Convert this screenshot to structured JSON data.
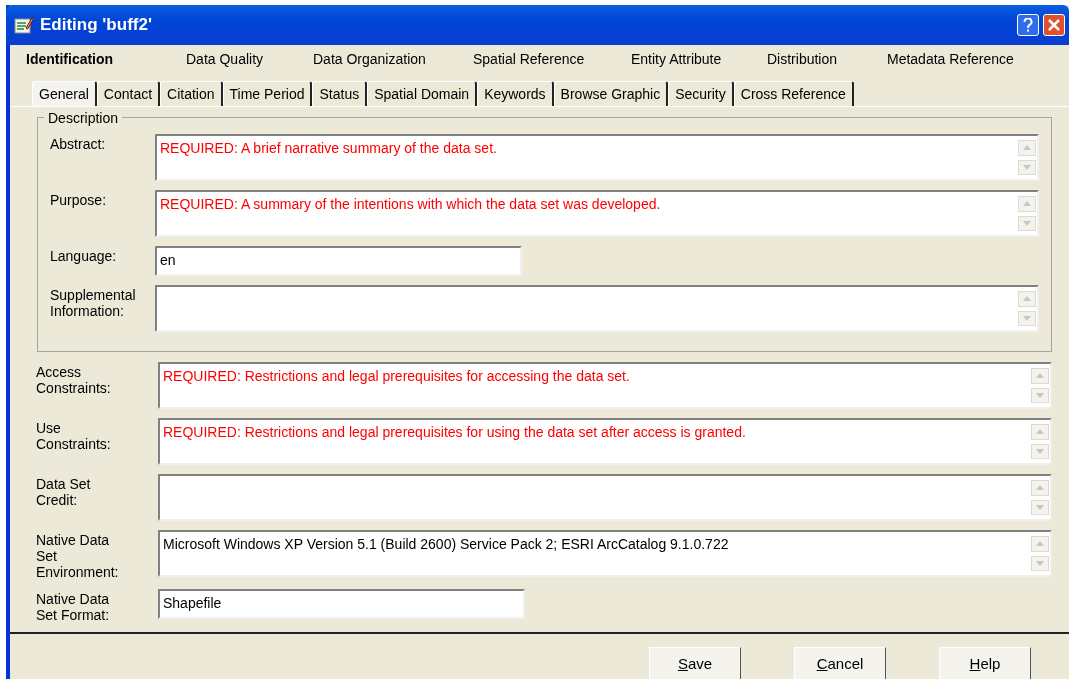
{
  "window": {
    "title": "Editing 'buff2'"
  },
  "main_tabs": [
    {
      "label": "Identification",
      "selected": true
    },
    {
      "label": "Data Quality",
      "selected": false
    },
    {
      "label": "Data Organization",
      "selected": false
    },
    {
      "label": "Spatial Reference",
      "selected": false
    },
    {
      "label": "Entity Attribute",
      "selected": false
    },
    {
      "label": "Distribution",
      "selected": false
    },
    {
      "label": "Metadata Reference",
      "selected": false
    }
  ],
  "sub_tabs": [
    {
      "label": "General",
      "selected": true
    },
    {
      "label": "Contact",
      "selected": false
    },
    {
      "label": "Citation",
      "selected": false
    },
    {
      "label": "Time Period",
      "selected": false
    },
    {
      "label": "Status",
      "selected": false
    },
    {
      "label": "Spatial Domain",
      "selected": false
    },
    {
      "label": "Keywords",
      "selected": false
    },
    {
      "label": "Browse Graphic",
      "selected": false
    },
    {
      "label": "Security",
      "selected": false
    },
    {
      "label": "Cross Reference",
      "selected": false
    }
  ],
  "description_group": {
    "title": "Description",
    "fields": [
      {
        "label": "Abstract:",
        "kind": "multiline",
        "value": "REQUIRED: A brief narrative summary of the data set.",
        "required": true
      },
      {
        "label": "Purpose:",
        "kind": "multiline",
        "value": "REQUIRED: A summary of the intentions with which the data set was developed.",
        "required": true
      },
      {
        "label": "Language:",
        "kind": "single",
        "value": "en",
        "required": false
      },
      {
        "label": "Supplemental Information:",
        "kind": "multiline"
      }
    ]
  },
  "fields": [
    {
      "label": "Access Constraints:",
      "kind": "multiline",
      "value": "REQUIRED: Restrictions and legal prerequisites for accessing the data set.",
      "required": true
    },
    {
      "label": "Use Constraints:",
      "kind": "multiline",
      "value": "REQUIRED: Restrictions and legal prerequisites for using the data set after access is granted.",
      "required": true
    },
    {
      "label": "Data Set Credit:",
      "kind": "multiline"
    },
    {
      "label": "Native Data Set Environment:",
      "kind": "multiline",
      "value": "Microsoft Windows XP Version 5.1 (Build 2600) Service Pack 2; ESRI ArcCatalog 9.1.0.722",
      "required": false
    },
    {
      "label": "Native Data Set Format:",
      "kind": "single",
      "value": "Shapefile",
      "required": false
    }
  ],
  "buttons": [
    {
      "label": "Save",
      "mnemonic": true
    },
    {
      "label": "Cancel",
      "mnemonic": true
    },
    {
      "label": "Help",
      "mnemonic": true
    }
  ]
}
